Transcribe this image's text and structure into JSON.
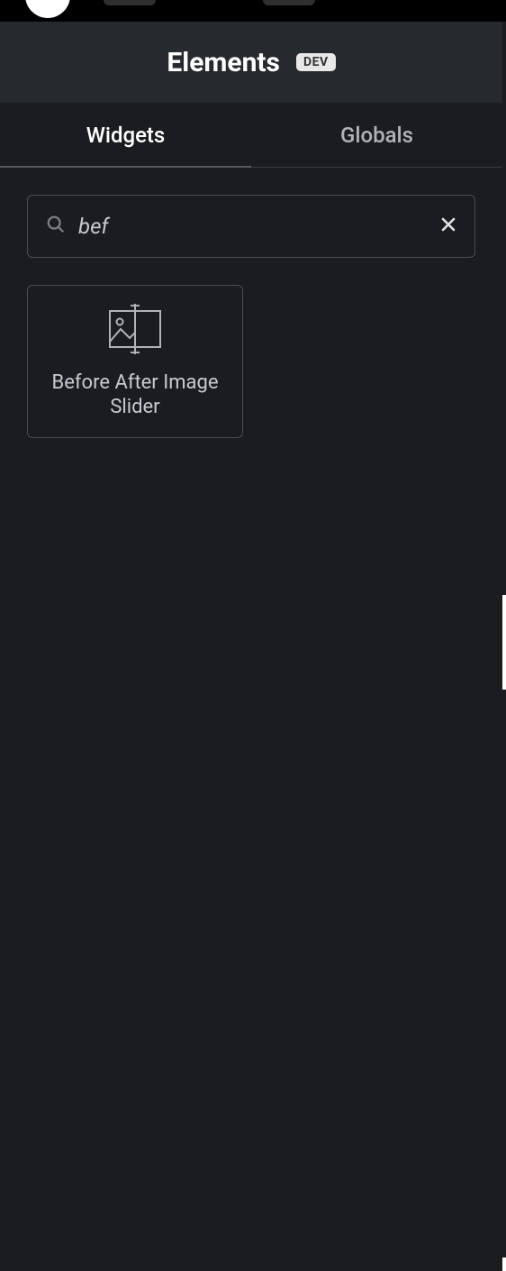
{
  "header": {
    "title": "Elements",
    "badge": "DEV"
  },
  "tabs": [
    {
      "label": "Widgets",
      "active": true
    },
    {
      "label": "Globals",
      "active": false
    }
  ],
  "search": {
    "value": "bef",
    "placeholder": ""
  },
  "widgets": [
    {
      "label": "Before After Image Slider",
      "icon": "before-after-slider-icon"
    }
  ]
}
